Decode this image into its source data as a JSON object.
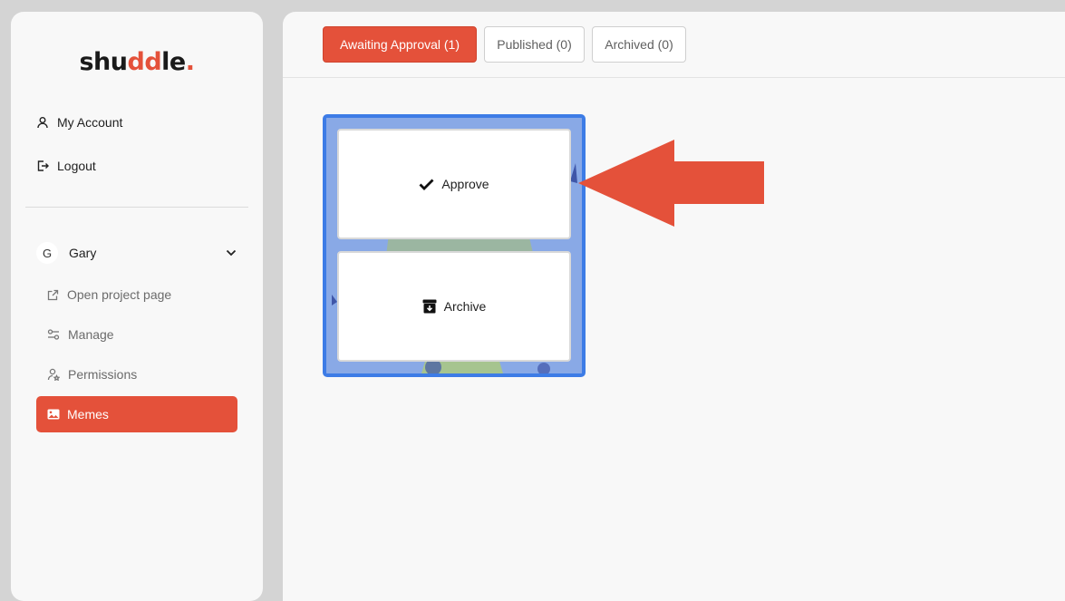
{
  "brand": {
    "logo_prefix": "shu",
    "logo_dd": "dd",
    "logo_suffix": "le",
    "logo_dot": "."
  },
  "sidebar": {
    "account_items": [
      {
        "label": "My Account",
        "icon": "user-icon"
      },
      {
        "label": "Logout",
        "icon": "logout-icon"
      }
    ],
    "project": {
      "avatar_initial": "G",
      "name": "Gary"
    },
    "project_items": [
      {
        "label": "Open project page",
        "icon": "external-link-icon"
      },
      {
        "label": "Manage",
        "icon": "sliders-icon"
      },
      {
        "label": "Permissions",
        "icon": "user-permission-icon"
      }
    ],
    "active_item": {
      "label": "Memes",
      "icon": "image-icon"
    }
  },
  "tabs": [
    {
      "label": "Awaiting Approval (1)",
      "active": true
    },
    {
      "label": "Published (0)",
      "active": false
    },
    {
      "label": "Archived (0)",
      "active": false
    }
  ],
  "meme_card": {
    "approve_label": "Approve",
    "archive_label": "Archive"
  },
  "colors": {
    "accent": "#e4513a",
    "card_border": "#3d7ce6",
    "arrow": "#e4513a"
  }
}
